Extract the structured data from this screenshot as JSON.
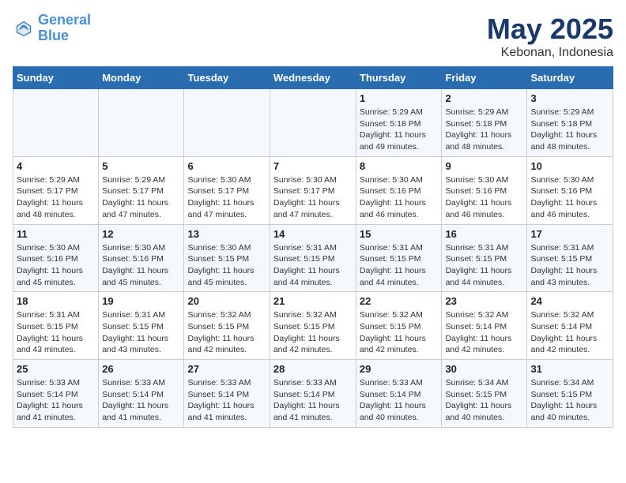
{
  "logo": {
    "line1": "General",
    "line2": "Blue"
  },
  "title": "May 2025",
  "subtitle": "Kebonan, Indonesia",
  "days_header": [
    "Sunday",
    "Monday",
    "Tuesday",
    "Wednesday",
    "Thursday",
    "Friday",
    "Saturday"
  ],
  "weeks": [
    [
      {
        "day": "",
        "detail": ""
      },
      {
        "day": "",
        "detail": ""
      },
      {
        "day": "",
        "detail": ""
      },
      {
        "day": "",
        "detail": ""
      },
      {
        "day": "1",
        "detail": "Sunrise: 5:29 AM\nSunset: 5:18 PM\nDaylight: 11 hours\nand 49 minutes."
      },
      {
        "day": "2",
        "detail": "Sunrise: 5:29 AM\nSunset: 5:18 PM\nDaylight: 11 hours\nand 48 minutes."
      },
      {
        "day": "3",
        "detail": "Sunrise: 5:29 AM\nSunset: 5:18 PM\nDaylight: 11 hours\nand 48 minutes."
      }
    ],
    [
      {
        "day": "4",
        "detail": "Sunrise: 5:29 AM\nSunset: 5:17 PM\nDaylight: 11 hours\nand 48 minutes."
      },
      {
        "day": "5",
        "detail": "Sunrise: 5:29 AM\nSunset: 5:17 PM\nDaylight: 11 hours\nand 47 minutes."
      },
      {
        "day": "6",
        "detail": "Sunrise: 5:30 AM\nSunset: 5:17 PM\nDaylight: 11 hours\nand 47 minutes."
      },
      {
        "day": "7",
        "detail": "Sunrise: 5:30 AM\nSunset: 5:17 PM\nDaylight: 11 hours\nand 47 minutes."
      },
      {
        "day": "8",
        "detail": "Sunrise: 5:30 AM\nSunset: 5:16 PM\nDaylight: 11 hours\nand 46 minutes."
      },
      {
        "day": "9",
        "detail": "Sunrise: 5:30 AM\nSunset: 5:16 PM\nDaylight: 11 hours\nand 46 minutes."
      },
      {
        "day": "10",
        "detail": "Sunrise: 5:30 AM\nSunset: 5:16 PM\nDaylight: 11 hours\nand 46 minutes."
      }
    ],
    [
      {
        "day": "11",
        "detail": "Sunrise: 5:30 AM\nSunset: 5:16 PM\nDaylight: 11 hours\nand 45 minutes."
      },
      {
        "day": "12",
        "detail": "Sunrise: 5:30 AM\nSunset: 5:16 PM\nDaylight: 11 hours\nand 45 minutes."
      },
      {
        "day": "13",
        "detail": "Sunrise: 5:30 AM\nSunset: 5:15 PM\nDaylight: 11 hours\nand 45 minutes."
      },
      {
        "day": "14",
        "detail": "Sunrise: 5:31 AM\nSunset: 5:15 PM\nDaylight: 11 hours\nand 44 minutes."
      },
      {
        "day": "15",
        "detail": "Sunrise: 5:31 AM\nSunset: 5:15 PM\nDaylight: 11 hours\nand 44 minutes."
      },
      {
        "day": "16",
        "detail": "Sunrise: 5:31 AM\nSunset: 5:15 PM\nDaylight: 11 hours\nand 44 minutes."
      },
      {
        "day": "17",
        "detail": "Sunrise: 5:31 AM\nSunset: 5:15 PM\nDaylight: 11 hours\nand 43 minutes."
      }
    ],
    [
      {
        "day": "18",
        "detail": "Sunrise: 5:31 AM\nSunset: 5:15 PM\nDaylight: 11 hours\nand 43 minutes."
      },
      {
        "day": "19",
        "detail": "Sunrise: 5:31 AM\nSunset: 5:15 PM\nDaylight: 11 hours\nand 43 minutes."
      },
      {
        "day": "20",
        "detail": "Sunrise: 5:32 AM\nSunset: 5:15 PM\nDaylight: 11 hours\nand 42 minutes."
      },
      {
        "day": "21",
        "detail": "Sunrise: 5:32 AM\nSunset: 5:15 PM\nDaylight: 11 hours\nand 42 minutes."
      },
      {
        "day": "22",
        "detail": "Sunrise: 5:32 AM\nSunset: 5:15 PM\nDaylight: 11 hours\nand 42 minutes."
      },
      {
        "day": "23",
        "detail": "Sunrise: 5:32 AM\nSunset: 5:14 PM\nDaylight: 11 hours\nand 42 minutes."
      },
      {
        "day": "24",
        "detail": "Sunrise: 5:32 AM\nSunset: 5:14 PM\nDaylight: 11 hours\nand 42 minutes."
      }
    ],
    [
      {
        "day": "25",
        "detail": "Sunrise: 5:33 AM\nSunset: 5:14 PM\nDaylight: 11 hours\nand 41 minutes."
      },
      {
        "day": "26",
        "detail": "Sunrise: 5:33 AM\nSunset: 5:14 PM\nDaylight: 11 hours\nand 41 minutes."
      },
      {
        "day": "27",
        "detail": "Sunrise: 5:33 AM\nSunset: 5:14 PM\nDaylight: 11 hours\nand 41 minutes."
      },
      {
        "day": "28",
        "detail": "Sunrise: 5:33 AM\nSunset: 5:14 PM\nDaylight: 11 hours\nand 41 minutes."
      },
      {
        "day": "29",
        "detail": "Sunrise: 5:33 AM\nSunset: 5:14 PM\nDaylight: 11 hours\nand 40 minutes."
      },
      {
        "day": "30",
        "detail": "Sunrise: 5:34 AM\nSunset: 5:15 PM\nDaylight: 11 hours\nand 40 minutes."
      },
      {
        "day": "31",
        "detail": "Sunrise: 5:34 AM\nSunset: 5:15 PM\nDaylight: 11 hours\nand 40 minutes."
      }
    ]
  ]
}
